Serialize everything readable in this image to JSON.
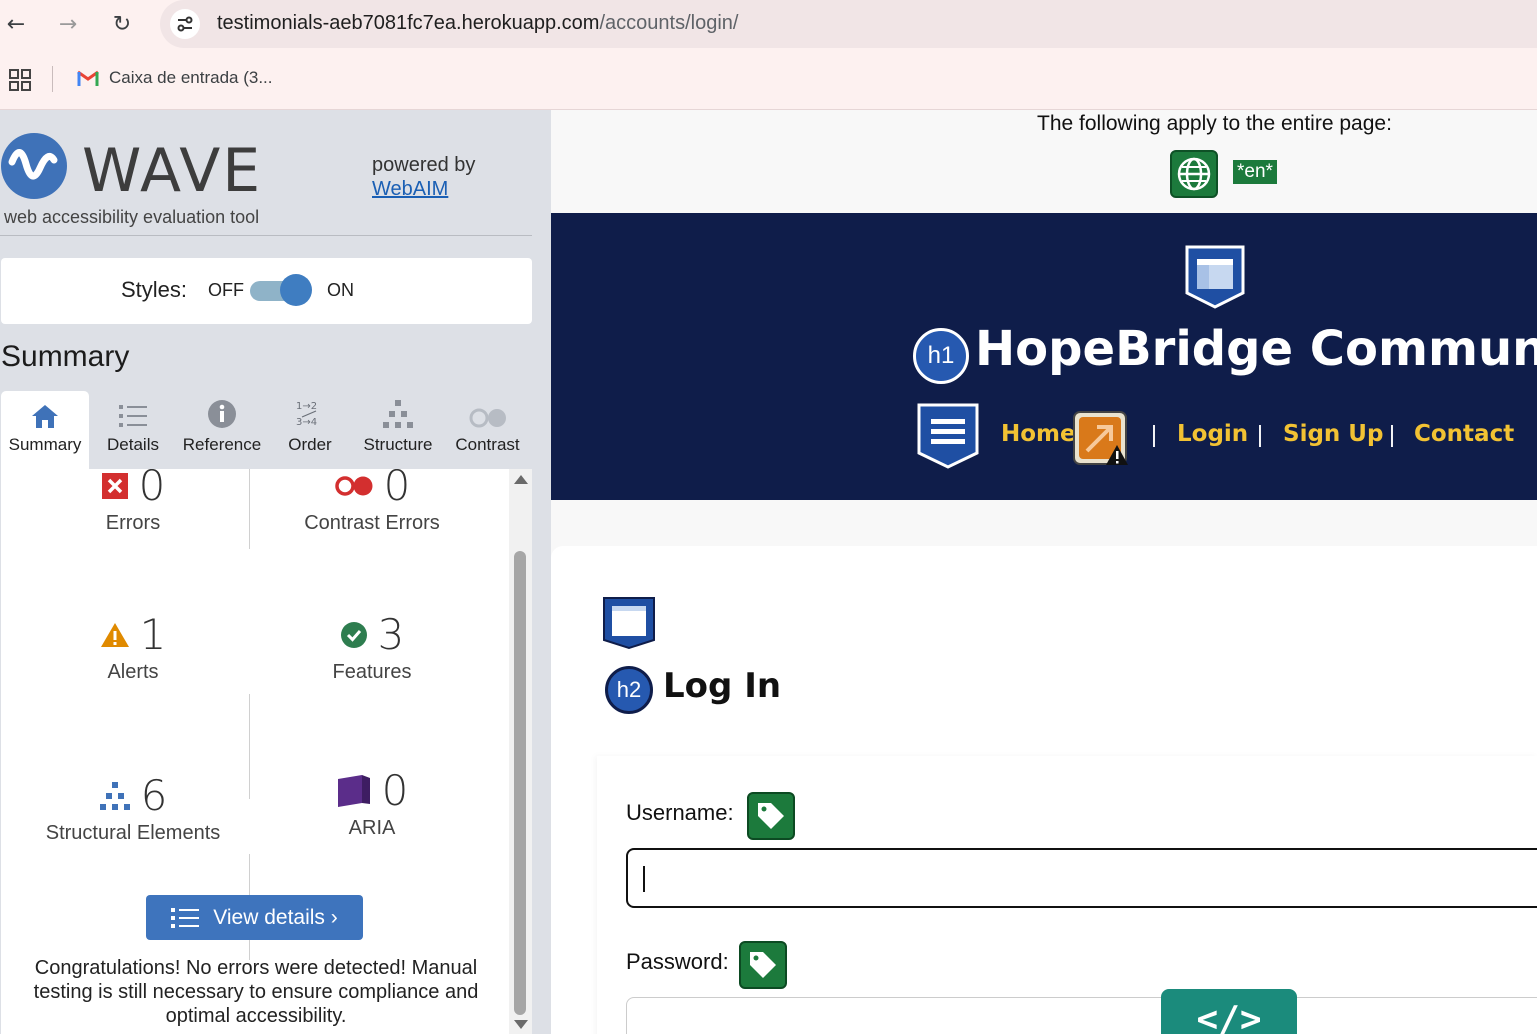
{
  "browser": {
    "url_host": "testimonials-aeb7081fc7ea.herokuapp.com",
    "url_path": "/accounts/login/",
    "bookmark": "Caixa de entrada (3..."
  },
  "wave": {
    "brand": "WAVE",
    "subtitle": "web accessibility evaluation tool",
    "powered_by": "powered by",
    "webaim": "WebAIM",
    "styles_label": "Styles:",
    "styles_off": "OFF",
    "styles_on": "ON",
    "summary_heading": "Summary",
    "tabs": [
      {
        "label": "Summary",
        "icon": "home-icon"
      },
      {
        "label": "Details",
        "icon": "list-icon"
      },
      {
        "label": "Reference",
        "icon": "info-icon"
      },
      {
        "label": "Order",
        "icon": "order-icon"
      },
      {
        "label": "Structure",
        "icon": "structure-icon"
      },
      {
        "label": "Contrast",
        "icon": "contrast-icon"
      }
    ],
    "stats": {
      "errors": {
        "count": "0",
        "label": "Errors"
      },
      "contrast_errors": {
        "count": "0",
        "label": "Contrast Errors"
      },
      "alerts": {
        "count": "1",
        "label": "Alerts"
      },
      "features": {
        "count": "3",
        "label": "Features"
      },
      "structural": {
        "count": "6",
        "label": "Structural Elements"
      },
      "aria": {
        "count": "0",
        "label": "ARIA"
      }
    },
    "view_details": "View details ›",
    "congrats": "Congratulations! No errors were detected! Manual testing is still necessary to ensure compliance and optimal accessibility.",
    "colors": {
      "accent": "#3e74bd",
      "error": "#d32f2f",
      "alert": "#e08a00",
      "feature": "#2e7d4f"
    }
  },
  "page": {
    "apply_text": "The following apply to the entire page:",
    "lang": "*en*",
    "h1_badge": "h1",
    "site_title": "HopeBridge Community",
    "nav": {
      "home": "Home",
      "login": "Login",
      "signup": "Sign Up",
      "contact": "Contact",
      "sep": "|"
    },
    "h2_badge": "h2",
    "login_title": "Log In",
    "username_label": "Username:",
    "password_label": "Password:",
    "code_icon": "</>",
    "colors": {
      "header_bg": "#0f1d4a",
      "nav_link": "#f2c233"
    }
  }
}
